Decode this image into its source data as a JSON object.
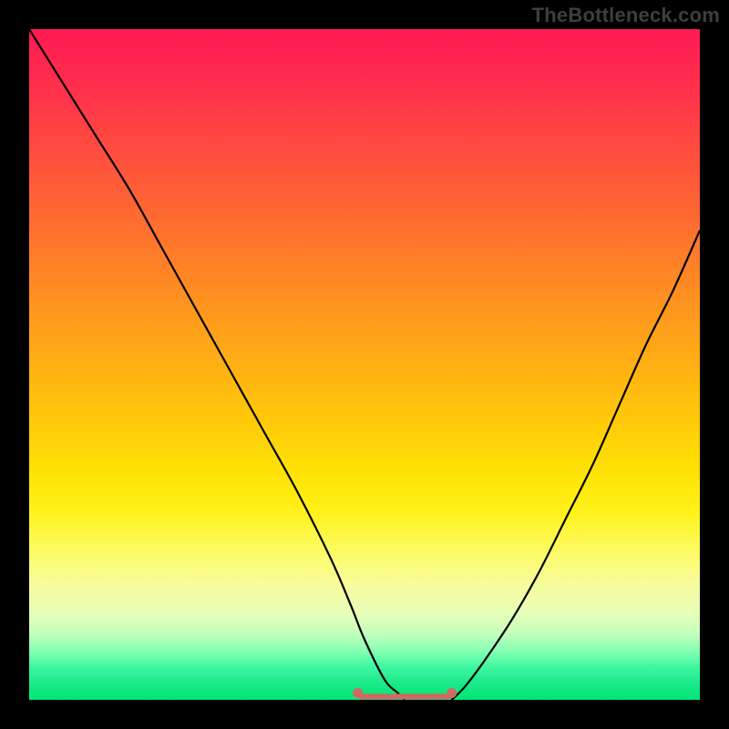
{
  "watermark": "TheBottleneck.com",
  "chart_data": {
    "type": "line",
    "title": "",
    "xlabel": "",
    "ylabel": "",
    "xlim": [
      0,
      100
    ],
    "ylim": [
      0,
      100
    ],
    "series": [
      {
        "name": "left-curve",
        "x": [
          0,
          5,
          10,
          15,
          20,
          25,
          30,
          35,
          40,
          45,
          48,
          50,
          53,
          55,
          56
        ],
        "values": [
          100,
          92,
          84,
          76,
          67,
          58,
          49,
          40,
          31,
          21,
          14,
          9,
          3,
          1,
          0
        ]
      },
      {
        "name": "right-curve",
        "x": [
          63,
          65,
          68,
          72,
          76,
          80,
          84,
          88,
          92,
          96,
          100
        ],
        "values": [
          0,
          2,
          6,
          12,
          19,
          27,
          35,
          44,
          53,
          61,
          70
        ]
      },
      {
        "name": "baseline-dash",
        "x": [
          49,
          50,
          51,
          52,
          53,
          54,
          55,
          56,
          57,
          58,
          59,
          60,
          61,
          62,
          63
        ],
        "values": [
          1,
          0.5,
          0.5,
          0.5,
          0.5,
          0.5,
          0.5,
          0.5,
          0.5,
          0.5,
          0.5,
          0.5,
          0.5,
          0.5,
          1
        ]
      }
    ],
    "annotations": [],
    "background_gradient_bands": 100
  },
  "colors": {
    "curve_black": "#000000",
    "dash_salmon": "#d06a63",
    "frame_black": "#000000"
  }
}
